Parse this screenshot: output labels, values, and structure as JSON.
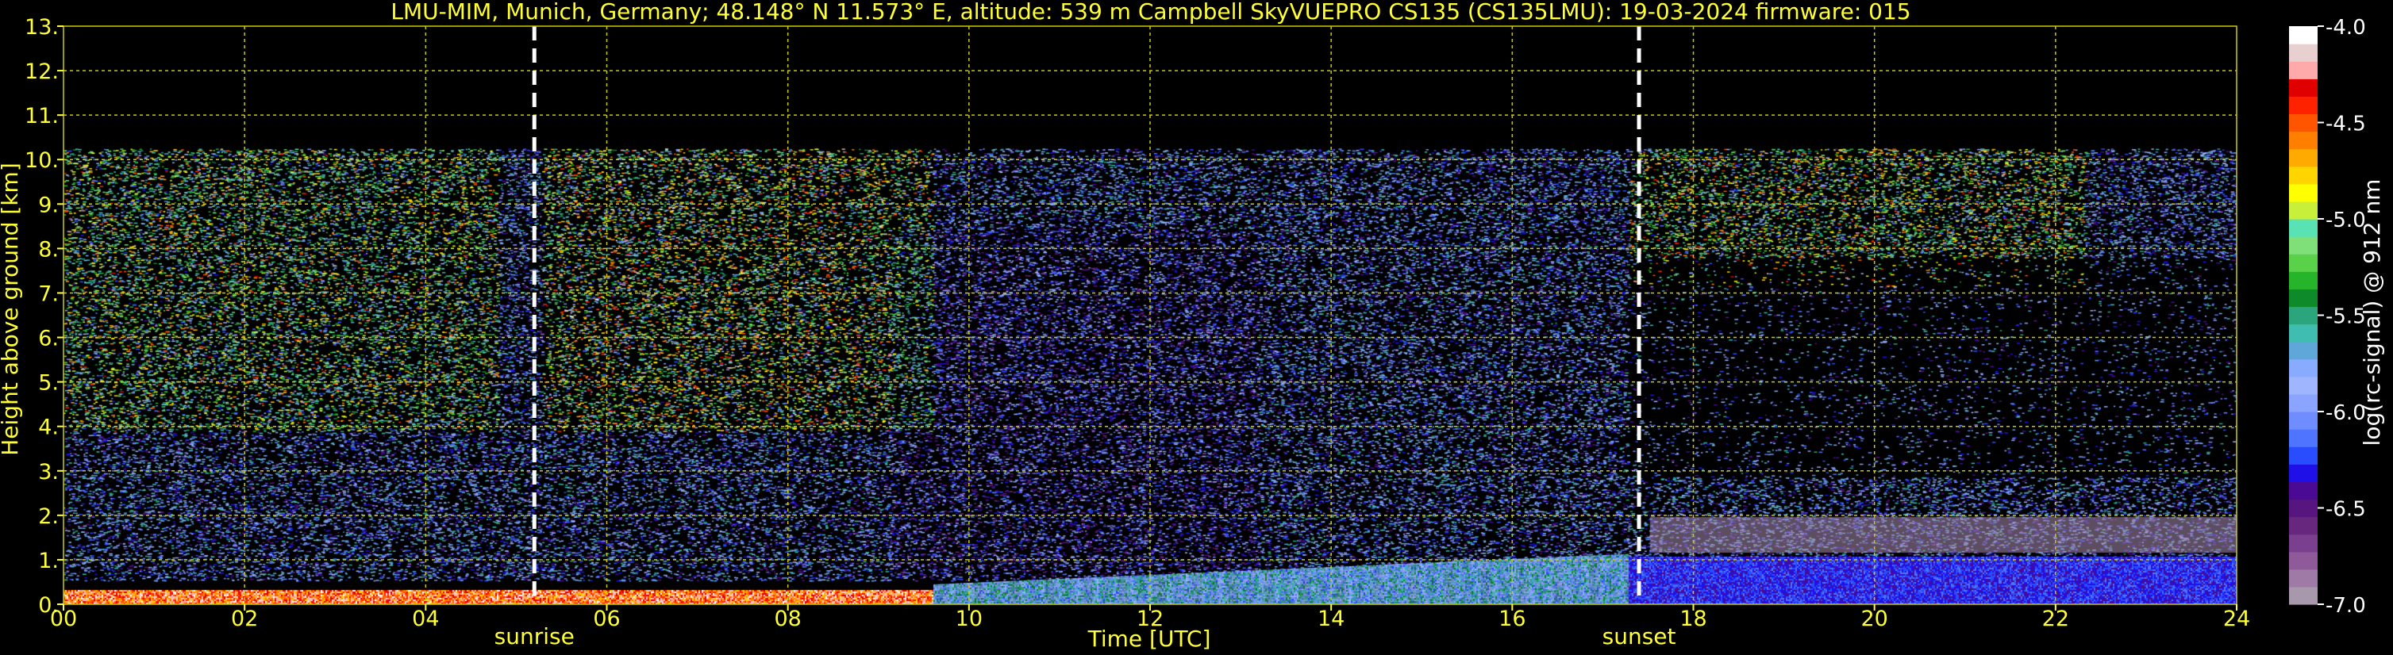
{
  "chart_data": {
    "type": "heatmap",
    "title": "LMU-MIM, Munich, Germany; 48.148° N 11.573° E, altitude: 539 m    Campbell SkyVUEPRO CS135 (CS135LMU): 19-03-2024    firmware: 015",
    "xlabel": "Time [UTC]",
    "ylabel": "Height above ground [km]",
    "xlim": [
      0,
      24
    ],
    "ylim": [
      0,
      13
    ],
    "x_ticks": [
      "00",
      "02",
      "04",
      "06",
      "08",
      "10",
      "12",
      "14",
      "16",
      "18",
      "20",
      "22",
      "24"
    ],
    "y_ticks": [
      "0.",
      "1.",
      "2.",
      "3.",
      "4.",
      "5.",
      "6.",
      "7.",
      "8.",
      "9.",
      "10.",
      "11.",
      "12.",
      "13."
    ],
    "grid": true,
    "colorbar": {
      "label": "log(rc-signal) @ 912 nm",
      "range": [
        -7.0,
        -4.0
      ],
      "ticks": [
        "-4.0",
        "-4.5",
        "-5.0",
        "-5.5",
        "-6.0",
        "-6.5",
        "-7.0"
      ],
      "colors": [
        "#a898ac",
        "#a07aa6",
        "#8e5a99",
        "#7a3f8e",
        "#67277f",
        "#57157f",
        "#4a0a93",
        "#1f10e8",
        "#2a4cff",
        "#4f74ff",
        "#6f8dff",
        "#8aa4ff",
        "#9fb6ff",
        "#88aaff",
        "#5fa7d8",
        "#3fbdb0",
        "#2aa57c",
        "#0f8a2a",
        "#26b52a",
        "#59d24a",
        "#7fe07a",
        "#59e3b5",
        "#c8f03a",
        "#ffff00",
        "#ffd500",
        "#ffaa00",
        "#ff8000",
        "#ff5500",
        "#ff2200",
        "#e00000",
        "#ffaaaa",
        "#e8d0d0",
        "#ffffff"
      ]
    },
    "markers": [
      {
        "label": "sunrise",
        "x": 5.2
      },
      {
        "label": "sunset",
        "x": 17.4
      }
    ]
  }
}
